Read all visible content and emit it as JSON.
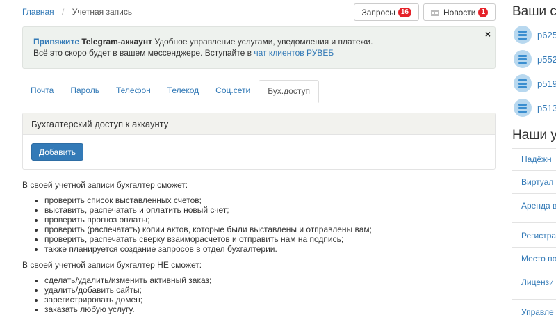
{
  "breadcrumb": {
    "home": "Главная",
    "current": "Учетная запись"
  },
  "top_buttons": {
    "requests_label": "Запросы",
    "requests_count": "16",
    "news_label": "Новости",
    "news_count": "1"
  },
  "alert": {
    "link_bold": "Привяжите",
    "bold": "Telegram-аккаунт",
    "text1": "Удобное управление услугами, уведомления и платежи.",
    "text2": "Всё это скоро будет в вашем мессенджере. Вступайте в",
    "link": "чат клиентов РУВЕБ",
    "close": "×"
  },
  "tabs": [
    "Почта",
    "Пароль",
    "Телефон",
    "Телекод",
    "Соц.сети",
    "Бух.доступ"
  ],
  "panel": {
    "title": "Бухгалтерский доступ к аккаунту",
    "add_button": "Добавить"
  },
  "can": {
    "heading": "В своей учетной записи бухгалтер сможет:",
    "items": [
      "проверить список выставленных счетов;",
      "выставить, распечатать и оплатить новый счет;",
      "проверить прогноз оплаты;",
      "проверить (распечатать) копии актов, которые были выставлены и отправлены вам;",
      "проверить, распечатать сверку взаиморасчетов и отправить нам на подпись;",
      "также планируется создание запросов в отдел бухгалтерии."
    ]
  },
  "cannot": {
    "heading": "В своей учетной записи бухгалтер НЕ сможет:",
    "items": [
      "сделать/удалить/изменить активный заказ;",
      "удалить/добавить сайты;",
      "зарегистрировать домен;",
      "заказать любую услугу."
    ]
  },
  "sidebar": {
    "servers_title": "Ваши с",
    "servers": [
      "p625",
      "p552",
      "p519",
      "p513"
    ],
    "services_title": "Наши у",
    "services_group1": [
      "Надёжн",
      "Виртуал",
      "Аренда в"
    ],
    "services_group2": [
      "Регистра",
      "Место по",
      "Лицензи"
    ],
    "services_group3": [
      "Управле"
    ]
  }
}
